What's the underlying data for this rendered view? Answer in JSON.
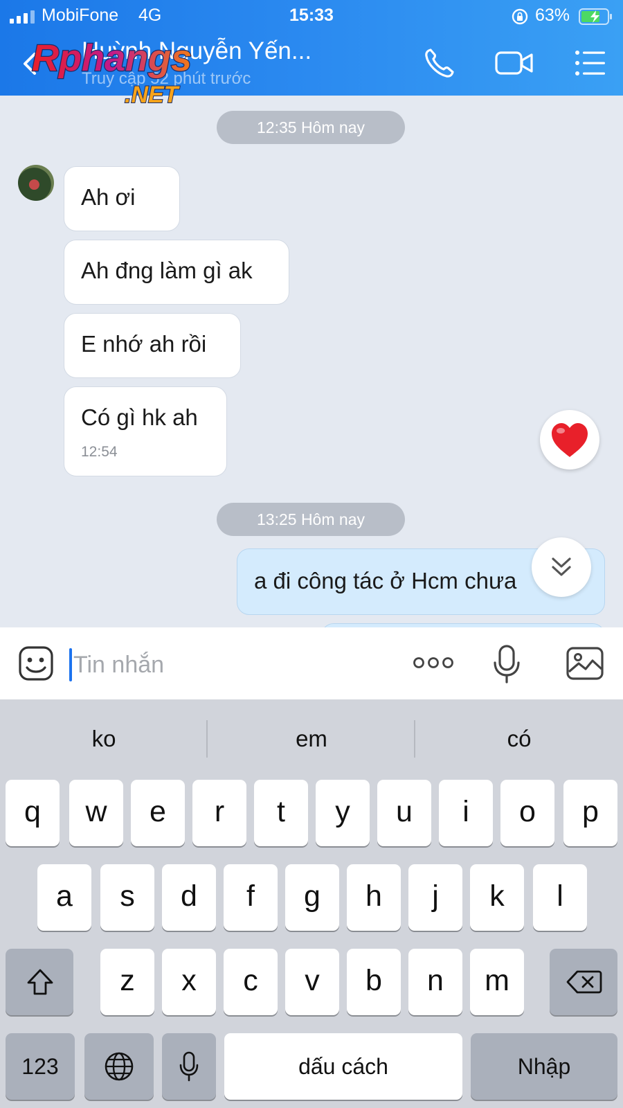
{
  "status_bar": {
    "carrier": "MobiFone",
    "network": "4G",
    "time": "15:33",
    "battery": "63%"
  },
  "header": {
    "contact_name": "Huỳnh Nguyễn Yến...",
    "last_seen": "Truy cập 52 phút trước",
    "watermark_text": "Rphangs.NET",
    "icons": [
      "back-icon",
      "phone-icon",
      "video-call-icon",
      "menu-list-icon"
    ]
  },
  "chat": {
    "time_dividers": [
      "12:35 Hôm nay",
      "13:25 Hôm nay"
    ],
    "incoming": [
      {
        "text": "Ah ơi"
      },
      {
        "text": "Ah đng làm gì ak"
      },
      {
        "text": "E nhớ ah rồi"
      },
      {
        "text": "Có gì hk ah",
        "time": "12:54"
      }
    ],
    "outgoing": [
      {
        "text": "a đi công tác ở Hcm chưa"
      }
    ],
    "reaction": "heart",
    "colors": {
      "outgoing_bubble": "#d4ebfd",
      "incoming_bubble": "#ffffff",
      "reaction": "#e8202a"
    }
  },
  "input": {
    "placeholder": "Tin nhắn",
    "value": ""
  },
  "keyboard": {
    "suggestions": [
      "ko",
      "em",
      "có"
    ],
    "row1": [
      "q",
      "w",
      "e",
      "r",
      "t",
      "y",
      "u",
      "i",
      "o",
      "p"
    ],
    "row2": [
      "a",
      "s",
      "d",
      "f",
      "g",
      "h",
      "j",
      "k",
      "l"
    ],
    "row3": [
      "z",
      "x",
      "c",
      "v",
      "b",
      "n",
      "m"
    ],
    "numbers_label": "123",
    "space_label": "dấu cách",
    "return_label": "Nhập"
  }
}
